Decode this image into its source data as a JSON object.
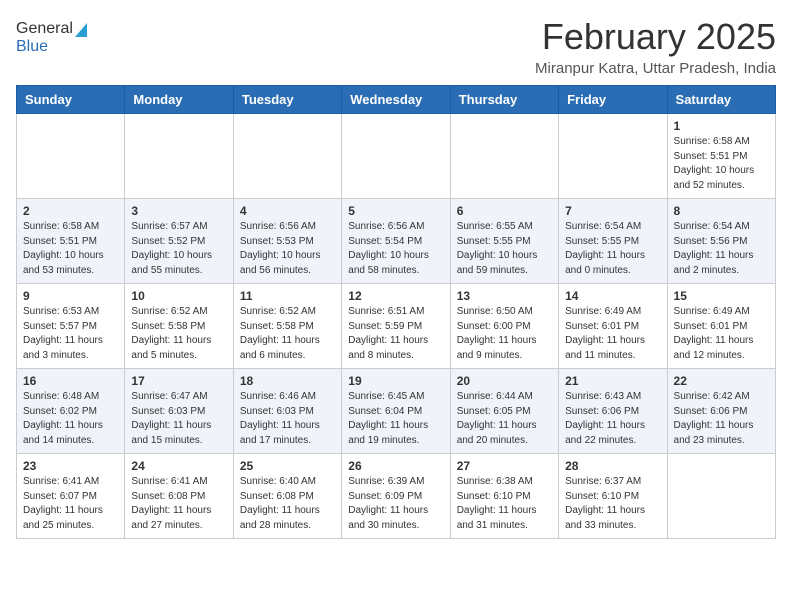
{
  "logo": {
    "general": "General",
    "blue": "Blue"
  },
  "title": {
    "month": "February 2025",
    "location": "Miranpur Katra, Uttar Pradesh, India"
  },
  "headers": [
    "Sunday",
    "Monday",
    "Tuesday",
    "Wednesday",
    "Thursday",
    "Friday",
    "Saturday"
  ],
  "weeks": [
    [
      {
        "day": "",
        "info": ""
      },
      {
        "day": "",
        "info": ""
      },
      {
        "day": "",
        "info": ""
      },
      {
        "day": "",
        "info": ""
      },
      {
        "day": "",
        "info": ""
      },
      {
        "day": "",
        "info": ""
      },
      {
        "day": "1",
        "info": "Sunrise: 6:58 AM\nSunset: 5:51 PM\nDaylight: 10 hours\nand 52 minutes."
      }
    ],
    [
      {
        "day": "2",
        "info": "Sunrise: 6:58 AM\nSunset: 5:51 PM\nDaylight: 10 hours\nand 53 minutes."
      },
      {
        "day": "3",
        "info": "Sunrise: 6:57 AM\nSunset: 5:52 PM\nDaylight: 10 hours\nand 55 minutes."
      },
      {
        "day": "4",
        "info": "Sunrise: 6:56 AM\nSunset: 5:53 PM\nDaylight: 10 hours\nand 56 minutes."
      },
      {
        "day": "5",
        "info": "Sunrise: 6:56 AM\nSunset: 5:54 PM\nDaylight: 10 hours\nand 58 minutes."
      },
      {
        "day": "6",
        "info": "Sunrise: 6:55 AM\nSunset: 5:55 PM\nDaylight: 10 hours\nand 59 minutes."
      },
      {
        "day": "7",
        "info": "Sunrise: 6:54 AM\nSunset: 5:55 PM\nDaylight: 11 hours\nand 0 minutes."
      },
      {
        "day": "8",
        "info": "Sunrise: 6:54 AM\nSunset: 5:56 PM\nDaylight: 11 hours\nand 2 minutes."
      }
    ],
    [
      {
        "day": "9",
        "info": "Sunrise: 6:53 AM\nSunset: 5:57 PM\nDaylight: 11 hours\nand 3 minutes."
      },
      {
        "day": "10",
        "info": "Sunrise: 6:52 AM\nSunset: 5:58 PM\nDaylight: 11 hours\nand 5 minutes."
      },
      {
        "day": "11",
        "info": "Sunrise: 6:52 AM\nSunset: 5:58 PM\nDaylight: 11 hours\nand 6 minutes."
      },
      {
        "day": "12",
        "info": "Sunrise: 6:51 AM\nSunset: 5:59 PM\nDaylight: 11 hours\nand 8 minutes."
      },
      {
        "day": "13",
        "info": "Sunrise: 6:50 AM\nSunset: 6:00 PM\nDaylight: 11 hours\nand 9 minutes."
      },
      {
        "day": "14",
        "info": "Sunrise: 6:49 AM\nSunset: 6:01 PM\nDaylight: 11 hours\nand 11 minutes."
      },
      {
        "day": "15",
        "info": "Sunrise: 6:49 AM\nSunset: 6:01 PM\nDaylight: 11 hours\nand 12 minutes."
      }
    ],
    [
      {
        "day": "16",
        "info": "Sunrise: 6:48 AM\nSunset: 6:02 PM\nDaylight: 11 hours\nand 14 minutes."
      },
      {
        "day": "17",
        "info": "Sunrise: 6:47 AM\nSunset: 6:03 PM\nDaylight: 11 hours\nand 15 minutes."
      },
      {
        "day": "18",
        "info": "Sunrise: 6:46 AM\nSunset: 6:03 PM\nDaylight: 11 hours\nand 17 minutes."
      },
      {
        "day": "19",
        "info": "Sunrise: 6:45 AM\nSunset: 6:04 PM\nDaylight: 11 hours\nand 19 minutes."
      },
      {
        "day": "20",
        "info": "Sunrise: 6:44 AM\nSunset: 6:05 PM\nDaylight: 11 hours\nand 20 minutes."
      },
      {
        "day": "21",
        "info": "Sunrise: 6:43 AM\nSunset: 6:06 PM\nDaylight: 11 hours\nand 22 minutes."
      },
      {
        "day": "22",
        "info": "Sunrise: 6:42 AM\nSunset: 6:06 PM\nDaylight: 11 hours\nand 23 minutes."
      }
    ],
    [
      {
        "day": "23",
        "info": "Sunrise: 6:41 AM\nSunset: 6:07 PM\nDaylight: 11 hours\nand 25 minutes."
      },
      {
        "day": "24",
        "info": "Sunrise: 6:41 AM\nSunset: 6:08 PM\nDaylight: 11 hours\nand 27 minutes."
      },
      {
        "day": "25",
        "info": "Sunrise: 6:40 AM\nSunset: 6:08 PM\nDaylight: 11 hours\nand 28 minutes."
      },
      {
        "day": "26",
        "info": "Sunrise: 6:39 AM\nSunset: 6:09 PM\nDaylight: 11 hours\nand 30 minutes."
      },
      {
        "day": "27",
        "info": "Sunrise: 6:38 AM\nSunset: 6:10 PM\nDaylight: 11 hours\nand 31 minutes."
      },
      {
        "day": "28",
        "info": "Sunrise: 6:37 AM\nSunset: 6:10 PM\nDaylight: 11 hours\nand 33 minutes."
      },
      {
        "day": "",
        "info": ""
      }
    ]
  ]
}
